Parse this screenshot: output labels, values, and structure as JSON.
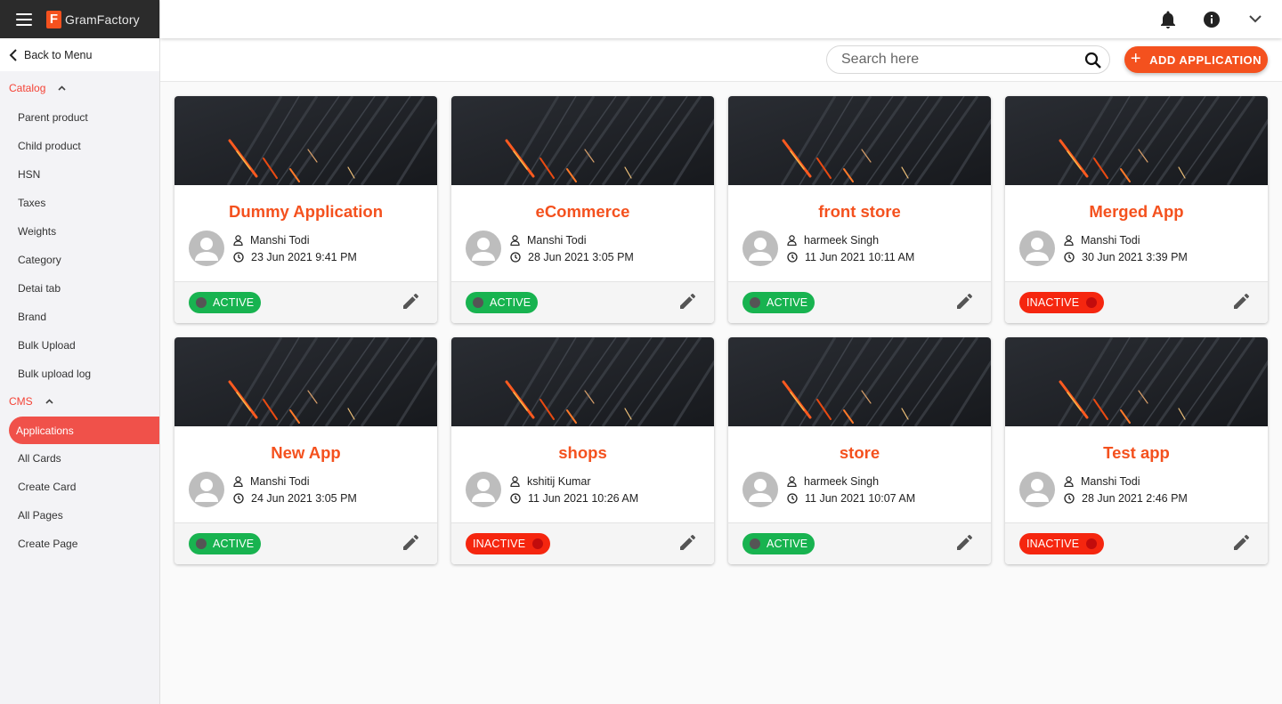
{
  "brand": {
    "name": "GramFactory",
    "logo_letter": "F",
    "accent": "#f4511e"
  },
  "sidebar": {
    "back_label": "Back to Menu",
    "sections": [
      {
        "title": "Catalog",
        "items": [
          "Parent product",
          "Child product",
          "HSN",
          "Taxes",
          "Weights",
          "Category",
          "Detai tab",
          "Brand",
          "Bulk Upload",
          "Bulk upload log"
        ]
      },
      {
        "title": "CMS",
        "items": [
          "Applications",
          "All Cards",
          "Create Card",
          "All Pages",
          "Create Page"
        ]
      }
    ],
    "active_item": "Applications"
  },
  "topbar": {
    "icons": [
      "bell-icon",
      "info-icon",
      "chevron-down-icon"
    ]
  },
  "toolbar": {
    "search_placeholder": "Search here",
    "add_label": "ADD APPLICATION"
  },
  "applications": [
    {
      "name": "Dummy Application",
      "owner": "Manshi Todi",
      "date": "23 Jun 2021 9:41 PM",
      "status": "ACTIVE"
    },
    {
      "name": "eCommerce",
      "owner": "Manshi Todi",
      "date": "28 Jun 2021 3:05 PM",
      "status": "ACTIVE"
    },
    {
      "name": "front store",
      "owner": "harmeek Singh",
      "date": "11 Jun 2021 10:11 AM",
      "status": "ACTIVE"
    },
    {
      "name": "Merged App",
      "owner": "Manshi Todi",
      "date": "30 Jun 2021 3:39 PM",
      "status": "INACTIVE"
    },
    {
      "name": "New App",
      "owner": "Manshi Todi",
      "date": "24 Jun 2021 3:05 PM",
      "status": "ACTIVE"
    },
    {
      "name": "shops",
      "owner": "kshitij Kumar",
      "date": "11 Jun 2021 10:26 AM",
      "status": "INACTIVE"
    },
    {
      "name": "store",
      "owner": "harmeek Singh",
      "date": "11 Jun 2021 10:07 AM",
      "status": "ACTIVE"
    },
    {
      "name": "Test app",
      "owner": "Manshi Todi",
      "date": "28 Jun 2021 2:46 PM",
      "status": "INACTIVE"
    }
  ],
  "colors": {
    "active": "#18b350",
    "inactive": "#f5260f",
    "title": "#f4511e"
  }
}
